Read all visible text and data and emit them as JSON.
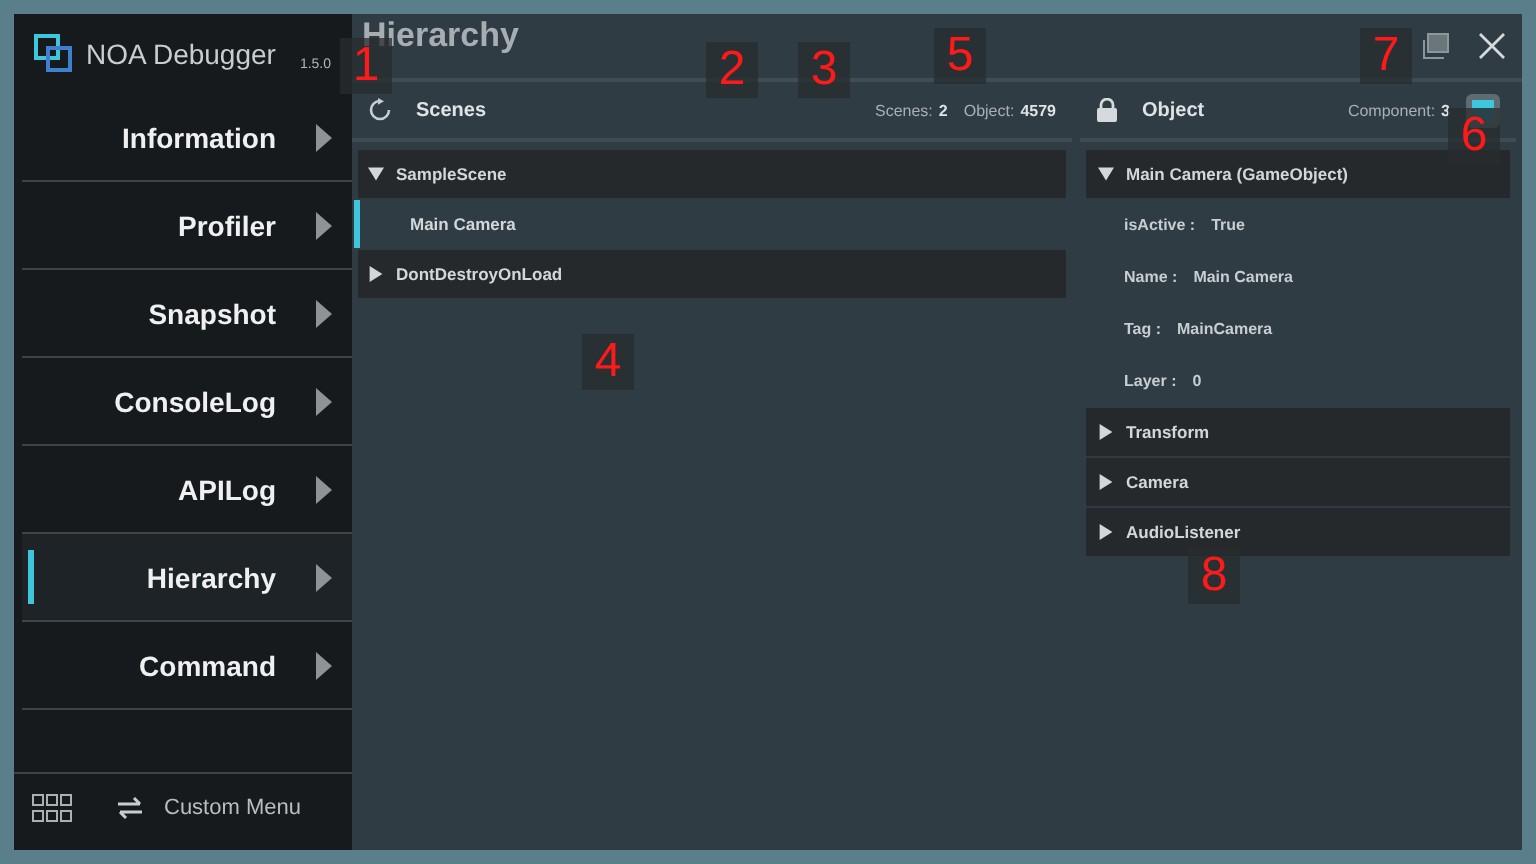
{
  "app": {
    "name": "NOA Debugger",
    "version": "1.5.0"
  },
  "sidebar": {
    "items": [
      {
        "label": "Information",
        "selected": false
      },
      {
        "label": "Profiler",
        "selected": false
      },
      {
        "label": "Snapshot",
        "selected": false
      },
      {
        "label": "ConsoleLog",
        "selected": false
      },
      {
        "label": "APILog",
        "selected": false
      },
      {
        "label": "Hierarchy",
        "selected": true
      },
      {
        "label": "Command",
        "selected": false
      }
    ],
    "custom_menu": "Custom Menu"
  },
  "header": {
    "title": "Hierarchy"
  },
  "scenes_panel": {
    "title": "Scenes",
    "scenes_label": "Scenes:",
    "scenes_count": "2",
    "object_label": "Object:",
    "object_count": "4579",
    "tree": [
      {
        "label": "SampleScene",
        "expanded": true,
        "children": [
          {
            "label": "Main Camera",
            "selected": true
          }
        ]
      },
      {
        "label": "DontDestroyOnLoad",
        "expanded": false
      }
    ]
  },
  "object_panel": {
    "title": "Object",
    "component_label": "Component:",
    "component_count": "3",
    "gameobject": {
      "label": "Main Camera (GameObject)",
      "expanded": true,
      "properties": [
        {
          "name": "isActive :",
          "value": "True"
        },
        {
          "name": "Name :",
          "value": "Main Camera"
        },
        {
          "name": "Tag :",
          "value": "MainCamera"
        },
        {
          "name": "Layer :",
          "value": "0"
        }
      ]
    },
    "components": [
      {
        "label": "Transform",
        "expanded": false
      },
      {
        "label": "Camera",
        "expanded": false
      },
      {
        "label": "AudioListener",
        "expanded": false
      }
    ]
  },
  "callouts": [
    "1",
    "2",
    "3",
    "4",
    "5",
    "6",
    "7",
    "8"
  ]
}
